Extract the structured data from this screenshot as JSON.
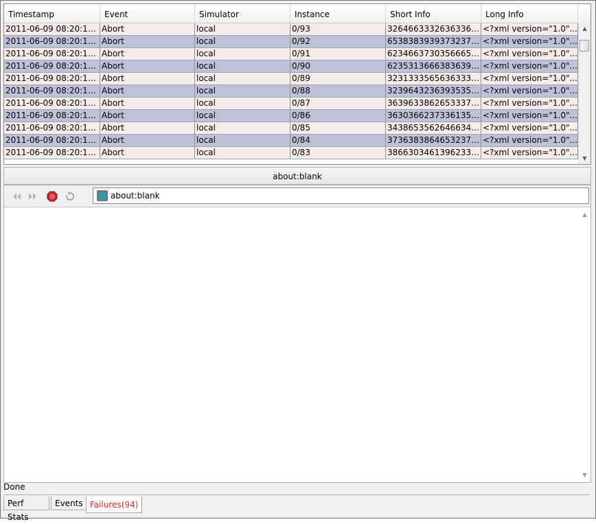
{
  "table": {
    "columns": [
      "Timestamp",
      "Event",
      "Simulator",
      "Instance",
      "Short Info",
      "Long Info"
    ],
    "rows": [
      [
        "2011-06-09 08:20:12...",
        "Abort",
        "local",
        "0/93",
        "32646633326363362...",
        "<?xml version=\"1.0\"..."
      ],
      [
        "2011-06-09 08:20:12...",
        "Abort",
        "local",
        "0/92",
        "65383839393732372...",
        "<?xml version=\"1.0\"..."
      ],
      [
        "2011-06-09 08:20:12...",
        "Abort",
        "local",
        "0/91",
        "62346637303566652...",
        "<?xml version=\"1.0\"..."
      ],
      [
        "2011-06-09 08:20:12...",
        "Abort",
        "local",
        "0/90",
        "62353136663836392...",
        "<?xml version=\"1.0\"..."
      ],
      [
        "2011-06-09 08:20:12...",
        "Abort",
        "local",
        "0/89",
        "32313335656363332...",
        "<?xml version=\"1.0\"..."
      ],
      [
        "2011-06-09 08:20:12...",
        "Abort",
        "local",
        "0/88",
        "32396432363935352...",
        "<?xml version=\"1.0\"..."
      ],
      [
        "2011-06-09 08:20:12...",
        "Abort",
        "local",
        "0/87",
        "36396338626533372...",
        "<?xml version=\"1.0\"..."
      ],
      [
        "2011-06-09 08:20:12...",
        "Abort",
        "local",
        "0/86",
        "36303662373361352...",
        "<?xml version=\"1.0\"..."
      ],
      [
        "2011-06-09 08:20:12...",
        "Abort",
        "local",
        "0/85",
        "34386535626466342...",
        "<?xml version=\"1.0\"..."
      ],
      [
        "2011-06-09 08:20:12...",
        "Abort",
        "local",
        "0/84",
        "37363838646532372...",
        "<?xml version=\"1.0\"..."
      ],
      [
        "2011-06-09 08:20:11...",
        "Abort",
        "local",
        "0/83",
        "38663034613962332...",
        "<?xml version=\"1.0\"..."
      ]
    ]
  },
  "browser": {
    "title": "about:blank",
    "address": "about:blank",
    "icons": {
      "back": "back-arrow-icon",
      "forward": "forward-arrow-icon",
      "stop": "stop-icon",
      "reload": "reload-icon",
      "page": "globe-icon"
    }
  },
  "status": "Done",
  "tabs": {
    "perf_stats": "Perf Stats",
    "events": "Events",
    "failures": "Failures(94)"
  },
  "colors": {
    "row_odd": "#f6ecea",
    "row_even": "#bec2d7",
    "active_tab_text": "#e02a2a",
    "stop_icon": "#c0282d"
  }
}
